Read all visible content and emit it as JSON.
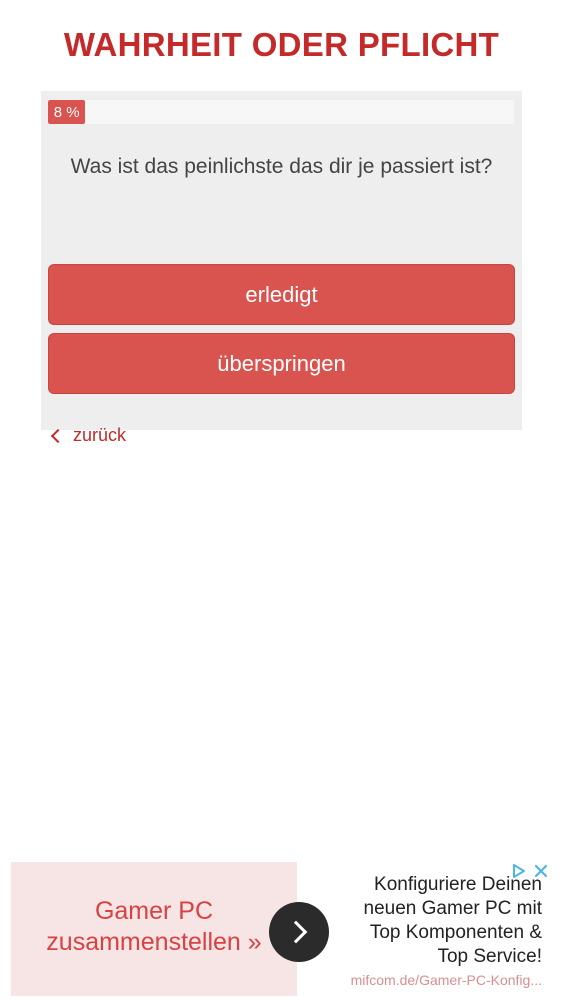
{
  "header": {
    "title": "WAHRHEIT ODER PFLICHT"
  },
  "progress": {
    "percent": 8,
    "label": "8 %"
  },
  "question": {
    "text": "Was ist das peinlichste das dir je passiert ist?"
  },
  "actions": {
    "done_label": "erledigt",
    "skip_label": "überspringen",
    "back_label": "zurück"
  },
  "ad": {
    "headline_line1": "Gamer PC",
    "headline_line2": "zusammenstellen »",
    "body_line1": "Konfiguriere Deinen",
    "body_line2": "neuen Gamer PC mit",
    "body_line3": "Top Komponenten &",
    "body_line4": "Top Service!",
    "url": "mifcom.de/Gamer-PC-Konfig...",
    "icons": {
      "cta": "chevron-right-icon",
      "choices": "adchoices-icon",
      "close": "close-icon"
    }
  },
  "colors": {
    "accent": "#c42a2a",
    "button": "#d9534f",
    "card_bg": "#eeeeee",
    "ad_left_bg": "#f7e4e4",
    "ad_choices": "#4fb5e3"
  }
}
